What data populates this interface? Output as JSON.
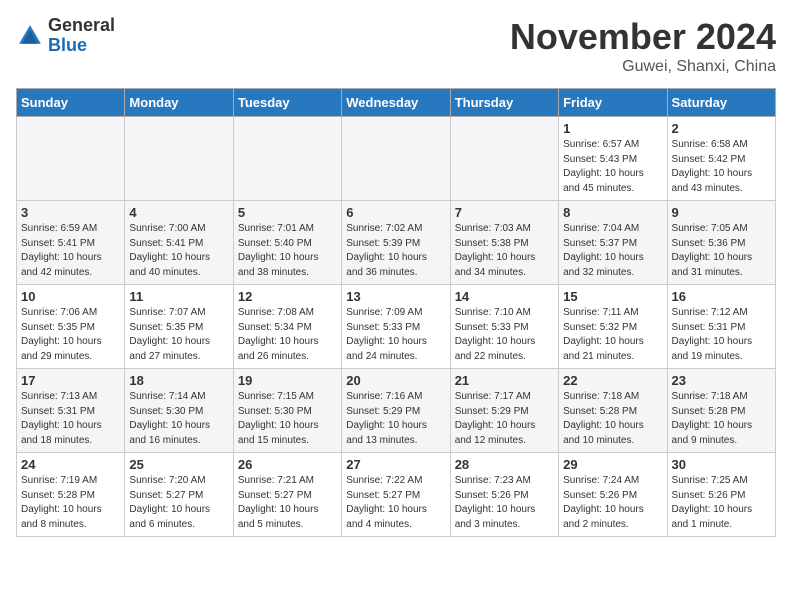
{
  "header": {
    "logo_line1": "General",
    "logo_line2": "Blue",
    "month": "November 2024",
    "location": "Guwei, Shanxi, China"
  },
  "weekdays": [
    "Sunday",
    "Monday",
    "Tuesday",
    "Wednesday",
    "Thursday",
    "Friday",
    "Saturday"
  ],
  "weeks": [
    [
      {
        "day": "",
        "empty": true
      },
      {
        "day": "",
        "empty": true
      },
      {
        "day": "",
        "empty": true
      },
      {
        "day": "",
        "empty": true
      },
      {
        "day": "",
        "empty": true
      },
      {
        "day": "1",
        "sunrise": "6:57 AM",
        "sunset": "5:43 PM",
        "daylight": "10 hours and 45 minutes."
      },
      {
        "day": "2",
        "sunrise": "6:58 AM",
        "sunset": "5:42 PM",
        "daylight": "10 hours and 43 minutes."
      }
    ],
    [
      {
        "day": "3",
        "sunrise": "6:59 AM",
        "sunset": "5:41 PM",
        "daylight": "10 hours and 42 minutes."
      },
      {
        "day": "4",
        "sunrise": "7:00 AM",
        "sunset": "5:41 PM",
        "daylight": "10 hours and 40 minutes."
      },
      {
        "day": "5",
        "sunrise": "7:01 AM",
        "sunset": "5:40 PM",
        "daylight": "10 hours and 38 minutes."
      },
      {
        "day": "6",
        "sunrise": "7:02 AM",
        "sunset": "5:39 PM",
        "daylight": "10 hours and 36 minutes."
      },
      {
        "day": "7",
        "sunrise": "7:03 AM",
        "sunset": "5:38 PM",
        "daylight": "10 hours and 34 minutes."
      },
      {
        "day": "8",
        "sunrise": "7:04 AM",
        "sunset": "5:37 PM",
        "daylight": "10 hours and 32 minutes."
      },
      {
        "day": "9",
        "sunrise": "7:05 AM",
        "sunset": "5:36 PM",
        "daylight": "10 hours and 31 minutes."
      }
    ],
    [
      {
        "day": "10",
        "sunrise": "7:06 AM",
        "sunset": "5:35 PM",
        "daylight": "10 hours and 29 minutes."
      },
      {
        "day": "11",
        "sunrise": "7:07 AM",
        "sunset": "5:35 PM",
        "daylight": "10 hours and 27 minutes."
      },
      {
        "day": "12",
        "sunrise": "7:08 AM",
        "sunset": "5:34 PM",
        "daylight": "10 hours and 26 minutes."
      },
      {
        "day": "13",
        "sunrise": "7:09 AM",
        "sunset": "5:33 PM",
        "daylight": "10 hours and 24 minutes."
      },
      {
        "day": "14",
        "sunrise": "7:10 AM",
        "sunset": "5:33 PM",
        "daylight": "10 hours and 22 minutes."
      },
      {
        "day": "15",
        "sunrise": "7:11 AM",
        "sunset": "5:32 PM",
        "daylight": "10 hours and 21 minutes."
      },
      {
        "day": "16",
        "sunrise": "7:12 AM",
        "sunset": "5:31 PM",
        "daylight": "10 hours and 19 minutes."
      }
    ],
    [
      {
        "day": "17",
        "sunrise": "7:13 AM",
        "sunset": "5:31 PM",
        "daylight": "10 hours and 18 minutes."
      },
      {
        "day": "18",
        "sunrise": "7:14 AM",
        "sunset": "5:30 PM",
        "daylight": "10 hours and 16 minutes."
      },
      {
        "day": "19",
        "sunrise": "7:15 AM",
        "sunset": "5:30 PM",
        "daylight": "10 hours and 15 minutes."
      },
      {
        "day": "20",
        "sunrise": "7:16 AM",
        "sunset": "5:29 PM",
        "daylight": "10 hours and 13 minutes."
      },
      {
        "day": "21",
        "sunrise": "7:17 AM",
        "sunset": "5:29 PM",
        "daylight": "10 hours and 12 minutes."
      },
      {
        "day": "22",
        "sunrise": "7:18 AM",
        "sunset": "5:28 PM",
        "daylight": "10 hours and 10 minutes."
      },
      {
        "day": "23",
        "sunrise": "7:18 AM",
        "sunset": "5:28 PM",
        "daylight": "10 hours and 9 minutes."
      }
    ],
    [
      {
        "day": "24",
        "sunrise": "7:19 AM",
        "sunset": "5:28 PM",
        "daylight": "10 hours and 8 minutes."
      },
      {
        "day": "25",
        "sunrise": "7:20 AM",
        "sunset": "5:27 PM",
        "daylight": "10 hours and 6 minutes."
      },
      {
        "day": "26",
        "sunrise": "7:21 AM",
        "sunset": "5:27 PM",
        "daylight": "10 hours and 5 minutes."
      },
      {
        "day": "27",
        "sunrise": "7:22 AM",
        "sunset": "5:27 PM",
        "daylight": "10 hours and 4 minutes."
      },
      {
        "day": "28",
        "sunrise": "7:23 AM",
        "sunset": "5:26 PM",
        "daylight": "10 hours and 3 minutes."
      },
      {
        "day": "29",
        "sunrise": "7:24 AM",
        "sunset": "5:26 PM",
        "daylight": "10 hours and 2 minutes."
      },
      {
        "day": "30",
        "sunrise": "7:25 AM",
        "sunset": "5:26 PM",
        "daylight": "10 hours and 1 minute."
      }
    ]
  ]
}
